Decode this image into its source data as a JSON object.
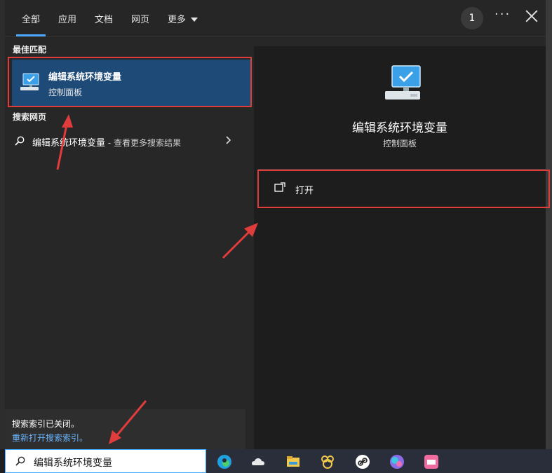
{
  "tabs": [
    "全部",
    "应用",
    "文档",
    "网页",
    "更多"
  ],
  "badge": "1",
  "ellipsis": "···",
  "sections": {
    "best_match": "最佳匹配",
    "search_web": "搜索网页"
  },
  "best_match": {
    "title": "编辑系统环境变量",
    "subtitle": "控制面板"
  },
  "web_result": {
    "query": "编辑系统环境变量",
    "suffix": " - 查看更多搜索结果"
  },
  "detail": {
    "title": "编辑系统环境变量",
    "subtitle": "控制面板",
    "open_label": "打开"
  },
  "notice": {
    "text": "搜索索引已关闭。",
    "link": "重新打开搜索索引。"
  },
  "search_box": {
    "value": "编辑系统环境变量"
  },
  "taskbar_icons": [
    "edge-icon",
    "onedrive-icon",
    "file-explorer-icon",
    "hedgehog-app-icon",
    "link-app-icon",
    "colorful-app-icon",
    "pink-app-icon"
  ],
  "colors": {
    "accent": "#4aa8ff",
    "highlight": "#1e4a78",
    "annotation": "#e03c3c"
  }
}
